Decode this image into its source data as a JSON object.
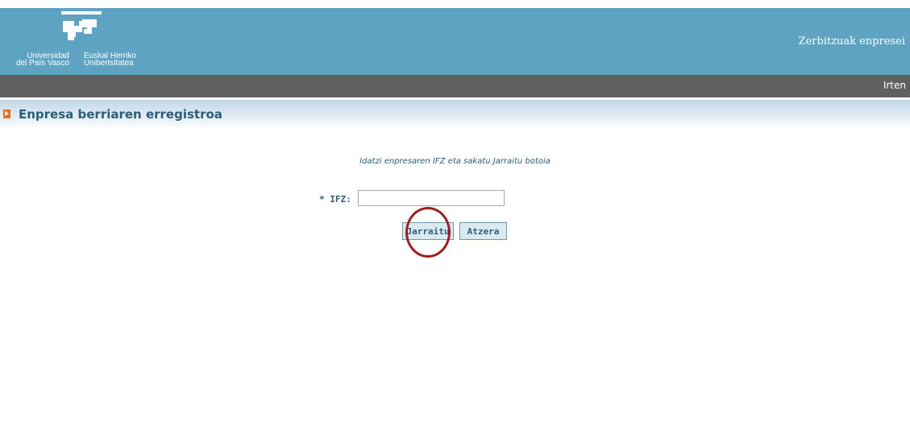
{
  "header": {
    "logo_es": "Universidad\ndel País Vasco",
    "logo_eu": "Euskal Herriko\nUnibertsitatea",
    "site_title": "Zerbitzuak enpresei"
  },
  "navbar": {
    "logout_label": "Irten"
  },
  "page": {
    "title": "Enpresa berriaren erregistroa",
    "instruction": "Idatzi enpresaren IFZ eta sakatu Jarraitu botoia"
  },
  "form": {
    "ifz_label": "* IFZ:",
    "ifz_value": "",
    "continue_label": "Jarraitu",
    "back_label": "Atzera"
  },
  "colors": {
    "header_bg": "#5fa3c2",
    "navbar_bg": "#606060",
    "accent": "#2b5e7d",
    "title_arrow": "#e86e1e",
    "annotation": "#a51c1c"
  }
}
